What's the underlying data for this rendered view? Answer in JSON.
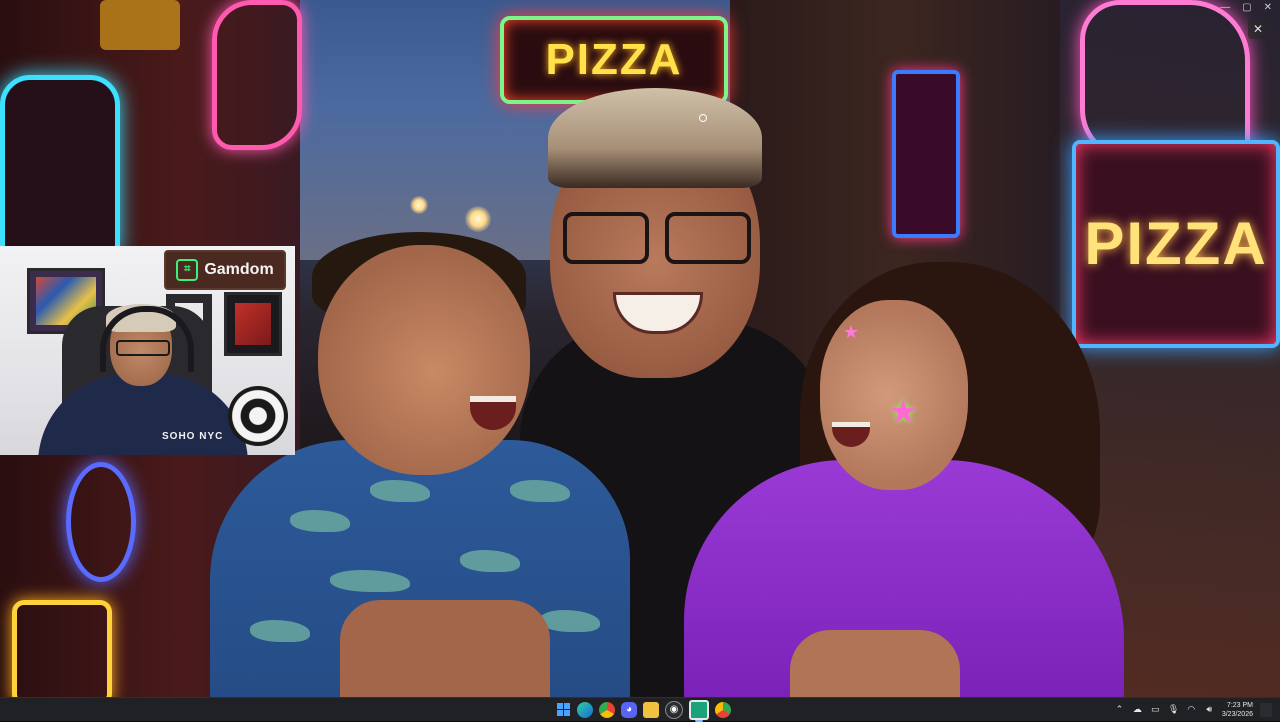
{
  "window": {
    "controls": {
      "minimize": "—",
      "maximize": "▢",
      "close": "✕"
    },
    "overlay_close": "✕"
  },
  "scene": {
    "signs": {
      "pizza_top": "PIZZA",
      "pizza_right": "PIZZA"
    }
  },
  "webcam": {
    "brand": "Gamdom",
    "brand_icon": "gamdom-logo-icon",
    "shirt_text": "SOHO NYC"
  },
  "taskbar": {
    "apps": [
      {
        "name": "start-icon"
      },
      {
        "name": "search-icon"
      },
      {
        "name": "edge-icon"
      },
      {
        "name": "chrome-icon"
      },
      {
        "name": "discord-icon"
      },
      {
        "name": "file-explorer-icon"
      },
      {
        "name": "obs-icon"
      },
      {
        "name": "app-icon"
      },
      {
        "name": "chrome-canary-icon"
      }
    ],
    "tray": {
      "clock_time": "7:23 PM",
      "clock_date": "3/23/2026",
      "icons": [
        "chevron-up-icon",
        "cloud-icon",
        "network-icon",
        "microphone-icon",
        "wifi-icon",
        "volume-icon"
      ]
    }
  }
}
